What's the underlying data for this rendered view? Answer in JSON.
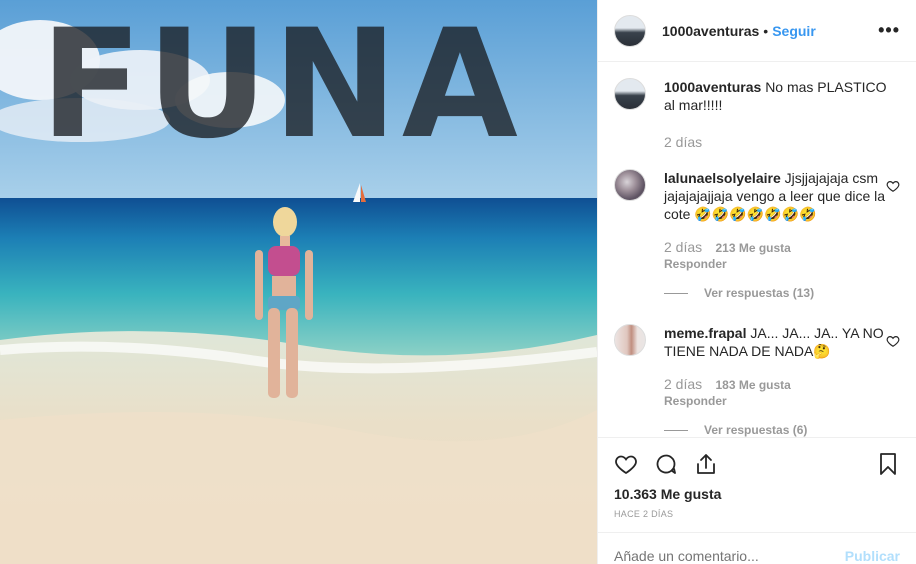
{
  "post": {
    "image_overlay_text": "FUNA",
    "author": "1000aventuras",
    "separator": "•",
    "follow_label": "Seguir",
    "more_label": "•••",
    "caption": {
      "user": "1000aventuras",
      "text": "No mas PLASTICO al mar!!!!!",
      "time": "2 días"
    },
    "comments": [
      {
        "user": "lalunaelsolyelaire",
        "text": "Jjsjjajajaja csm jajajajajjaja vengo a leer que dice la cote 🤣🤣🤣🤣🤣🤣🤣",
        "time": "2 días",
        "likes": "213 Me gusta",
        "reply_label": "Responder",
        "view_replies": "Ver respuestas (13)"
      },
      {
        "user": "meme.frapal",
        "text": "JA... JA... JA.. YA NO TIENE NADA DE NADA🤔",
        "time": "2 días",
        "likes": "183 Me gusta",
        "reply_label": "Responder",
        "view_replies": "Ver respuestas (6)"
      }
    ],
    "likes_count": "10.363 Me gusta",
    "date": "HACE 2 DÍAS",
    "add_comment_placeholder": "Añade un comentario...",
    "publish_label": "Publicar"
  }
}
